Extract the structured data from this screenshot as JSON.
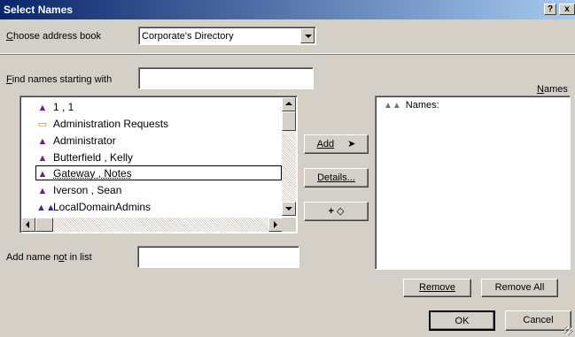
{
  "window": {
    "title": "Select Names",
    "help_btn": "?",
    "close_btn": "x"
  },
  "address_book": {
    "label_prefix": "C",
    "label_rest": "hoose address book",
    "value": "Corporate's Directory"
  },
  "find": {
    "label_prefix": "F",
    "label_rest": "ind names starting with",
    "value": ""
  },
  "names_panel_label": {
    "prefix": "N",
    "rest": "ames"
  },
  "list": {
    "items": [
      {
        "label": "1 , 1",
        "icon": "person-icon"
      },
      {
        "label": "Administration Requests",
        "icon": "folder-icon"
      },
      {
        "label": "Administrator",
        "icon": "person-icon"
      },
      {
        "label": "Butterfield , Kelly",
        "icon": "person-icon"
      },
      {
        "label": "Gateway , Notes",
        "icon": "person-icon"
      },
      {
        "label": "Iverson , Sean",
        "icon": "person-icon"
      },
      {
        "label": "LocalDomainAdmins",
        "icon": "group-icon"
      }
    ]
  },
  "buttons": {
    "add": "Add",
    "details": "Details...",
    "add_entry": "+",
    "remove": "Remove",
    "remove_all": "Remove All",
    "ok": "OK",
    "cancel": "Cancel"
  },
  "names_list": {
    "header": "Names:"
  },
  "add_not_in_list": {
    "label_a": "Add name n",
    "label_u": "o",
    "label_b": "t in list",
    "value": ""
  },
  "colors": {
    "titlebar": "#0a246a",
    "dialog": "#d4d0c8",
    "person_icon": "#7a1d8c"
  }
}
